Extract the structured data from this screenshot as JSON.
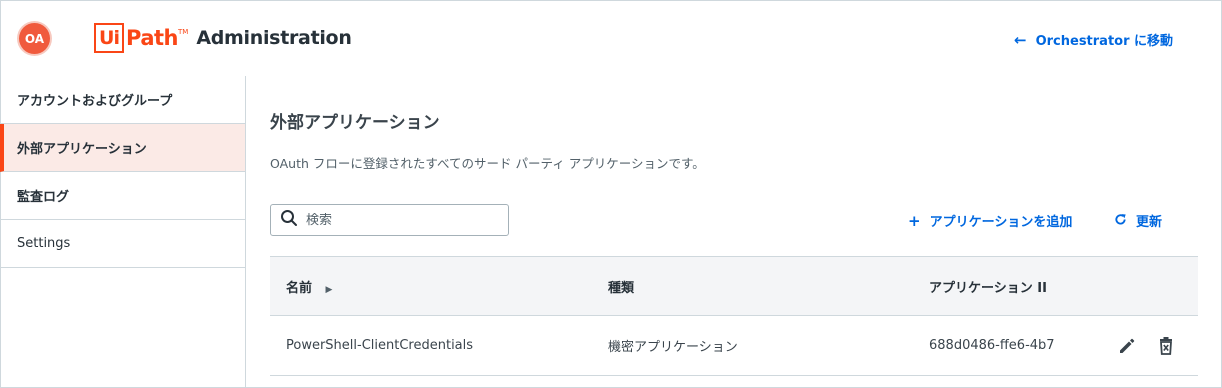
{
  "header": {
    "avatar_initials": "OA",
    "logo_ui": "Ui",
    "logo_path": "Path",
    "logo_tm": "TM",
    "title": "Administration",
    "goto_orchestrator": "Orchestrator に移動"
  },
  "sidebar": {
    "items": [
      {
        "label": "アカウントおよびグループ",
        "active": false
      },
      {
        "label": "外部アプリケーション",
        "active": true
      },
      {
        "label": "監査ログ",
        "active": false
      },
      {
        "label": "Settings",
        "active": false
      }
    ]
  },
  "main": {
    "title": "外部アプリケーション",
    "description": "OAuth フローに登録されたすべてのサード パーティ アプリケーションです。",
    "search": {
      "placeholder": "検索",
      "value": ""
    },
    "add_app_label": "アプリケーションを追加",
    "refresh_label": "更新",
    "table": {
      "columns": [
        "名前",
        "種類",
        "アプリケーション II"
      ],
      "rows": [
        {
          "name": "PowerShell-ClientCredentials",
          "type": "機密アプリケーション",
          "app_id": "688d0486-ffe6-4b7"
        }
      ]
    }
  },
  "colors": {
    "brand": "#fa4616",
    "accent_blue": "#0067df",
    "active_bg": "#fbeae6",
    "header_row_bg": "#f4f5f7"
  },
  "icons": [
    "arrow-left-icon",
    "search-icon",
    "plus-icon",
    "refresh-icon",
    "sort-caret-icon",
    "edit-pencil-icon",
    "delete-trash-icon"
  ]
}
